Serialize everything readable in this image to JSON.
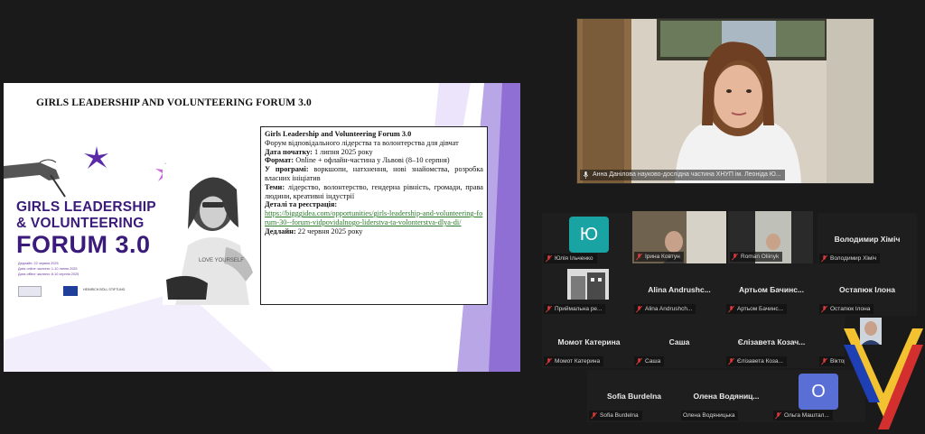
{
  "slide": {
    "title": "GIRLS LEADERSHIP AND VOLUNTEERING FORUM 3.0",
    "poster": {
      "line1": "GIRLS LEADERSHIP",
      "line2": "& VOLUNTEERING",
      "line3": "FORUM 3.0",
      "date1": "Дедлайн: 22 червня 2025",
      "date2": "Дата online частини: 1-10 липня 2025",
      "date3": "Дата offline частини: 8-10 серпня 2025",
      "partner": "HEINRICH BÖLL STIFTUNG"
    },
    "info": {
      "heading": "Girls Leadership and Volunteering Forum 3.0",
      "subtitle": "Форум відповідального лідерства та волонтерства для дівчат",
      "start_label": "Дата початку:",
      "start_value": " 1 липня 2025 року",
      "format_label": "Формат:",
      "format_value": " Online + офлайн-частина у Львові (8–10 серпня)",
      "program_label": "У програмі:",
      "program_value": " воркшопи, натхнення, нові знайомства, розробка власних ініціатив",
      "topics_label": "Теми:",
      "topics_value": " лідерство, волонтерство, гендерна рівність, громади, права людини, креативні індустрії",
      "details_label": "Деталі та реєстрація:",
      "link": "https://bigggidea.com/opportunities/girls-leadership-and-volunteering-forum-30--forum-vidpovidalnogo-liderstva-ta-volonterstva-dlya-di/",
      "deadline_label": "Дедлайн:",
      "deadline_value": " 22 червня 2025 року"
    }
  },
  "speaker": {
    "label": "Анна Данілова науково-дослідна частина ХНУП ім. Леоніда Ю..."
  },
  "participants": [
    {
      "display": "",
      "avatar": "Ю",
      "avatar_color": "#1aa3a3",
      "label": "Юлія Ільченко"
    },
    {
      "display": "",
      "avatar": "",
      "label": "Ірина Ковтун"
    },
    {
      "display": "",
      "avatar": "",
      "label": "Roman Oliinyk"
    },
    {
      "display": "Володимир  Хіміч",
      "avatar": "",
      "label": "Володимир Хіміч"
    },
    {
      "display": "",
      "avatar": "",
      "label": "Приймальна ре..."
    },
    {
      "display": "Alina  Andrushc...",
      "avatar": "",
      "label": "Alina Andrushch..."
    },
    {
      "display": "Артьом  Бачинс...",
      "avatar": "",
      "label": "Артьом Бачинс..."
    },
    {
      "display": "Остапюк Ілона",
      "avatar": "",
      "label": "Остапюк Ілона"
    },
    {
      "display": "Момот Катерина",
      "avatar": "",
      "label": "Момот Катерина"
    },
    {
      "display": "Саша",
      "avatar": "",
      "label": "Саша"
    },
    {
      "display": "Єлізавета  Козач...",
      "avatar": "",
      "label": "Єлізавета Коза..."
    },
    {
      "display": "",
      "avatar": "",
      "label": "Віктор..."
    },
    {
      "display": "Sofia Burdelna",
      "avatar": "",
      "label": "Sofia Burdelna"
    },
    {
      "display": "Олена  Водяниц...",
      "avatar": "",
      "label": "Олена Водяницька"
    },
    {
      "display": "",
      "avatar": "О",
      "avatar_color": "#5a6fd6",
      "label": "Ольга Маштал..."
    }
  ],
  "colors": {
    "background": "#1a1a1a",
    "poster_purple": "#3a1a7a",
    "link_green": "#2a7a2a",
    "mic_red": "#e03a3a"
  },
  "icons": [
    "mic-off-icon",
    "audio-icon",
    "brand-logo"
  ]
}
